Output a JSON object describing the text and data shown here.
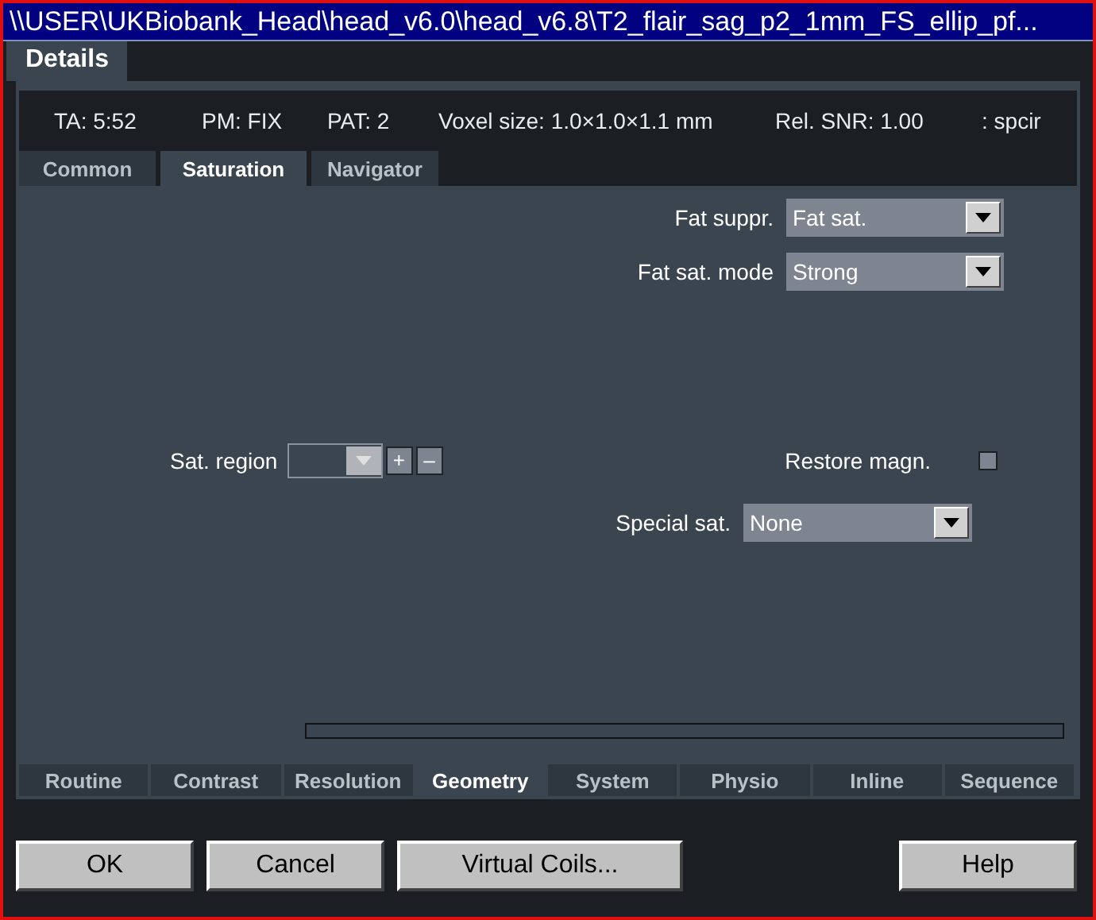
{
  "window": {
    "title": "\\\\USER\\UKBiobank_Head\\head_v6.0\\head_v6.8\\T2_flair_sag_p2_1mm_FS_ellip_pf..."
  },
  "main_tabs": [
    {
      "label": "Details",
      "selected": true
    }
  ],
  "info": [
    "TA: 5:52",
    "PM: FIX",
    "PAT: 2",
    "Voxel size: 1.0×1.0×1.1 mm",
    "Rel. SNR: 1.00",
    ": spcir"
  ],
  "top_tabs": [
    {
      "label": "Common",
      "selected": false
    },
    {
      "label": "Saturation",
      "selected": true
    },
    {
      "label": "Navigator",
      "selected": false
    }
  ],
  "fat_suppr": {
    "label": "Fat suppr.",
    "value": "Fat sat."
  },
  "fat_sat_mode": {
    "label": "Fat sat. mode",
    "value": "Strong"
  },
  "sat_region": {
    "label": "Sat. region",
    "add": "+",
    "remove": "–"
  },
  "restore_magn": {
    "label": "Restore magn.",
    "checked": false
  },
  "special_sat": {
    "label": "Special sat.",
    "value": "None"
  },
  "progress": {
    "level": 0
  },
  "bottom_tabs": [
    {
      "label": "Routine",
      "selected": false
    },
    {
      "label": "Contrast",
      "selected": false
    },
    {
      "label": "Resolution",
      "selected": false
    },
    {
      "label": "Geometry",
      "selected": true
    },
    {
      "label": "System",
      "selected": false
    },
    {
      "label": "Physio",
      "selected": false
    },
    {
      "label": "Inline",
      "selected": false
    },
    {
      "label": "Sequence",
      "selected": false
    }
  ],
  "buttons_left": [
    "OK",
    "Cancel",
    "Virtual Coils..."
  ],
  "buttons_right": [
    "Help"
  ]
}
